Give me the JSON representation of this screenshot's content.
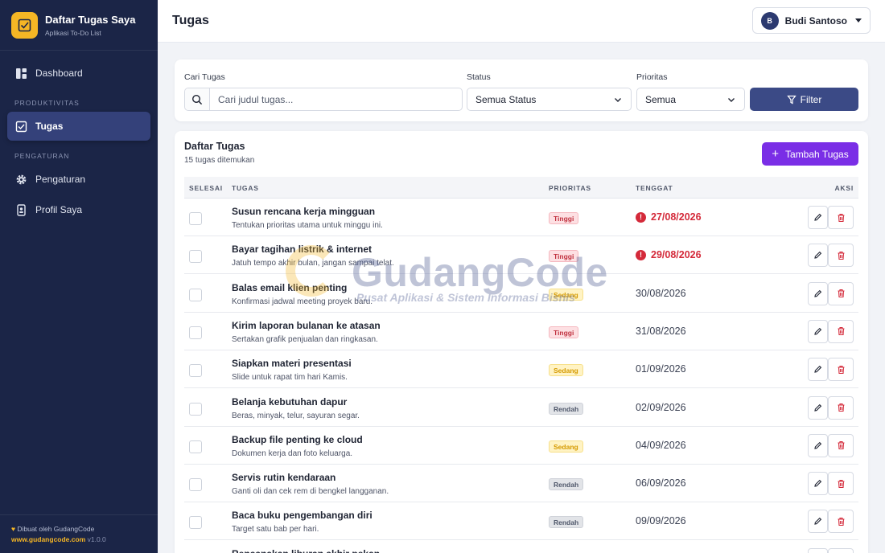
{
  "brand": {
    "title": "Daftar Tugas Saya",
    "subtitle": "Aplikasi To-Do List"
  },
  "sidebar": {
    "items": [
      {
        "label": "Dashboard",
        "icon": "dashboard-icon"
      },
      {
        "label": "Tugas",
        "icon": "checkbox-icon",
        "active": true
      },
      {
        "label": "Pengaturan",
        "icon": "gear-icon"
      },
      {
        "label": "Profil Saya",
        "icon": "id-card-icon"
      }
    ],
    "sections": [
      "PRODUKTIVITAS",
      "PENGATURAN"
    ],
    "footer": {
      "credit": "Dibuat oleh GudangCode",
      "site": "www.gudangcode.com",
      "version": "v1.0.0"
    }
  },
  "header": {
    "title": "Tugas",
    "user_initial": "B",
    "user_name": "Budi Santoso"
  },
  "filters": {
    "search_label": "Cari Tugas",
    "search_placeholder": "Cari judul tugas...",
    "status_label": "Status",
    "status_value": "Semua Status",
    "priority_label": "Prioritas",
    "priority_value": "Semua",
    "filter_button": "Filter"
  },
  "list": {
    "title": "Daftar Tugas",
    "count": "15 tugas ditemukan",
    "add_button": "Tambah Tugas",
    "columns": [
      "SELESAI",
      "TUGAS",
      "PRIORITAS",
      "TENGGAT",
      "AKSI"
    ],
    "rows": [
      {
        "title": "Susun rencana kerja mingguan",
        "desc": "Tentukan prioritas utama untuk minggu ini.",
        "priority": "Tinggi",
        "due": "27/08/2026",
        "overdue": true
      },
      {
        "title": "Bayar tagihan listrik & internet",
        "desc": "Jatuh tempo akhir bulan, jangan sampai telat.",
        "priority": "Tinggi",
        "due": "29/08/2026",
        "overdue": true
      },
      {
        "title": "Balas email klien penting",
        "desc": "Konfirmasi jadwal meeting proyek baru.",
        "priority": "Sedang",
        "due": "30/08/2026",
        "overdue": false
      },
      {
        "title": "Kirim laporan bulanan ke atasan",
        "desc": "Sertakan grafik penjualan dan ringkasan.",
        "priority": "Tinggi",
        "due": "31/08/2026",
        "overdue": false
      },
      {
        "title": "Siapkan materi presentasi",
        "desc": "Slide untuk rapat tim hari Kamis.",
        "priority": "Sedang",
        "due": "01/09/2026",
        "overdue": false
      },
      {
        "title": "Belanja kebutuhan dapur",
        "desc": "Beras, minyak, telur, sayuran segar.",
        "priority": "Rendah",
        "due": "02/09/2026",
        "overdue": false
      },
      {
        "title": "Backup file penting ke cloud",
        "desc": "Dokumen kerja dan foto keluarga.",
        "priority": "Sedang",
        "due": "04/09/2026",
        "overdue": false
      },
      {
        "title": "Servis rutin kendaraan",
        "desc": "Ganti oli dan cek rem di bengkel langganan.",
        "priority": "Rendah",
        "due": "06/09/2026",
        "overdue": false
      },
      {
        "title": "Baca buku pengembangan diri",
        "desc": "Target satu bab per hari.",
        "priority": "Rendah",
        "due": "09/09/2026",
        "overdue": false
      },
      {
        "title": "Rencanakan liburan akhir pekan",
        "desc": "",
        "priority": "",
        "due": "",
        "overdue": false
      }
    ]
  },
  "watermark": {
    "name": "GudangCode",
    "tagline": "Pusat Aplikasi & Sistem Informasi Bisnis"
  },
  "colors": {
    "sidebar": "#1b2547",
    "accent": "#3b4a86",
    "add_button": "#7a2ee6",
    "brand_yellow": "#f5b625",
    "danger": "#d42a3a"
  }
}
